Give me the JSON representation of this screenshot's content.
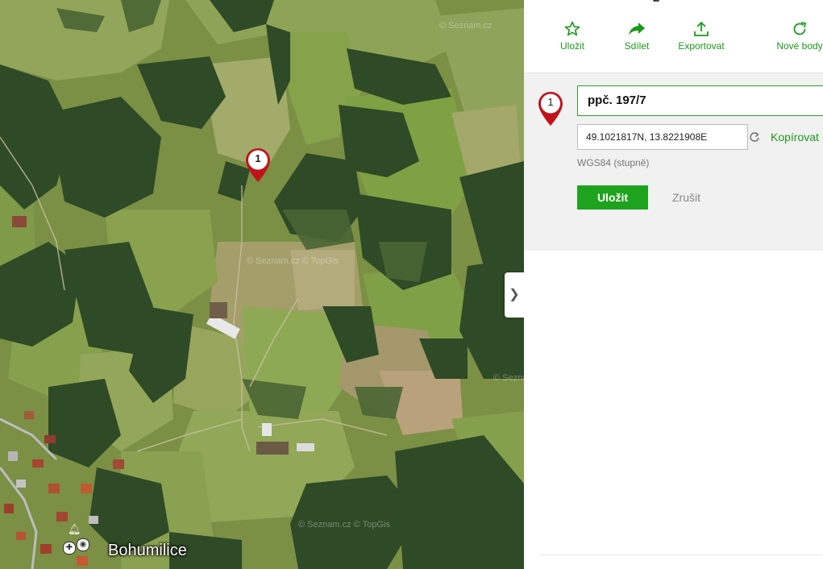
{
  "map": {
    "watermarks": [
      "© Seznam.cz",
      "© Seznam.cz © TopGis",
      "© Seznam.cz",
      "© Seznam.cz © TopGis"
    ],
    "marker_number": "1",
    "town_label": "Bohumilice",
    "poi_icons": [
      "church-icon",
      "camera-icon",
      "bell-icon"
    ]
  },
  "toolbar": {
    "save_label": "Uložit",
    "share_label": "Sdílet",
    "export_label": "Exportovat",
    "new_points_label": "Nové body"
  },
  "point": {
    "number": "1",
    "name_value": "ppč. 197/7",
    "coords_value": "49.1021817N, 13.8221908E",
    "copy_label": "Kopírovat",
    "coord_system_label": "WGS84 (stupně)",
    "save_label": "Uložit",
    "cancel_label": "Zrušit"
  },
  "panel_toggle_glyph": "❯",
  "colors": {
    "accent_green": "#1ea31e",
    "marker_red": "#c0141c"
  }
}
